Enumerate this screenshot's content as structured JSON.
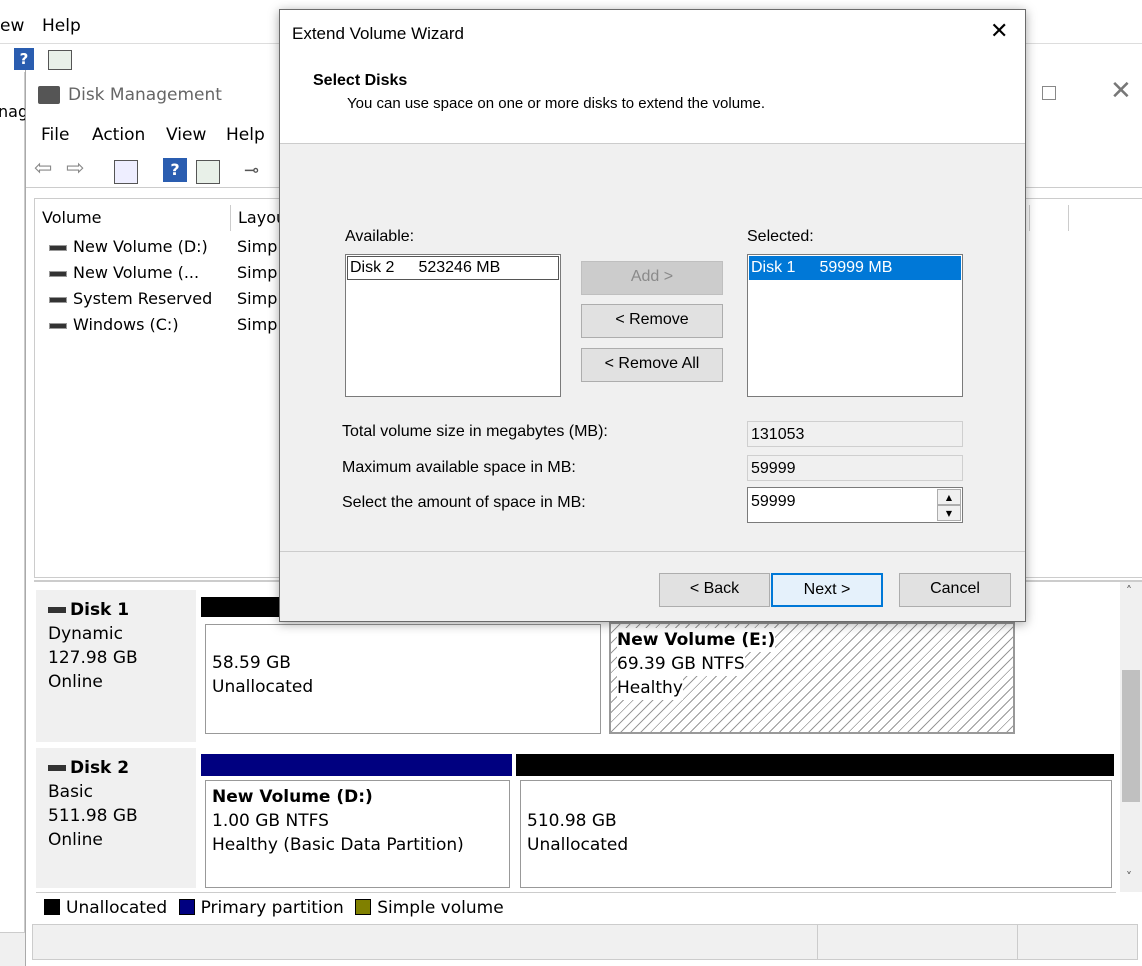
{
  "back_window": {
    "menu": [
      "ew",
      "Help"
    ],
    "left_fragment": "nager"
  },
  "disk_management": {
    "title": "Disk Management",
    "menu": [
      "File",
      "Action",
      "View",
      "Help"
    ],
    "columns": [
      "Volume",
      "Layou"
    ],
    "volumes": [
      {
        "name": "New Volume (D:)",
        "layout": "Simp"
      },
      {
        "name": "New Volume (...",
        "layout": "Simp"
      },
      {
        "name": "System Reserved",
        "layout": "Simp"
      },
      {
        "name": "Windows (C:)",
        "layout": "Simp"
      }
    ],
    "disks": [
      {
        "name": "Disk 1",
        "type": "Dynamic",
        "size": "127.98 GB",
        "status": "Online",
        "partitions": [
          {
            "title": "",
            "line1": "58.59 GB",
            "line2": "Unallocated"
          },
          {
            "title": "New Volume  (E:)",
            "line1": "69.39 GB NTFS",
            "line2": "Healthy"
          }
        ]
      },
      {
        "name": "Disk 2",
        "type": "Basic",
        "size": "511.98 GB",
        "status": "Online",
        "partitions": [
          {
            "title": "New Volume  (D:)",
            "line1": "1.00 GB NTFS",
            "line2": "Healthy (Basic Data Partition)"
          },
          {
            "title": "",
            "line1": "510.98 GB",
            "line2": "Unallocated"
          }
        ]
      }
    ],
    "legend": [
      {
        "label": "Unallocated",
        "color": "#000000"
      },
      {
        "label": "Primary partition",
        "color": "#000080"
      },
      {
        "label": "Simple volume",
        "color": "#808000"
      }
    ]
  },
  "wizard": {
    "title": "Extend Volume Wizard",
    "heading": "Select Disks",
    "subheading": "You can use space on one or more disks to extend the volume.",
    "available_label": "Available:",
    "selected_label": "Selected:",
    "available_items": [
      {
        "disk": "Disk 2",
        "size": "523246 MB"
      }
    ],
    "selected_items": [
      {
        "disk": "Disk 1",
        "size": "59999 MB"
      }
    ],
    "add_button": "Add >",
    "remove_button": "< Remove",
    "remove_all_button": "< Remove All",
    "total_label": "Total volume size in megabytes (MB):",
    "total_value": "131053",
    "max_label": "Maximum available space in MB:",
    "max_value": "59999",
    "amount_label": "Select the amount of space in MB:",
    "amount_value": "59999",
    "back_button": "< Back",
    "next_button": "Next >",
    "cancel_button": "Cancel"
  },
  "colors": {
    "selection": "#0078d7",
    "primary_partition": "#000080",
    "unallocated": "#000000",
    "dialog_bg": "#f0f0f0"
  }
}
